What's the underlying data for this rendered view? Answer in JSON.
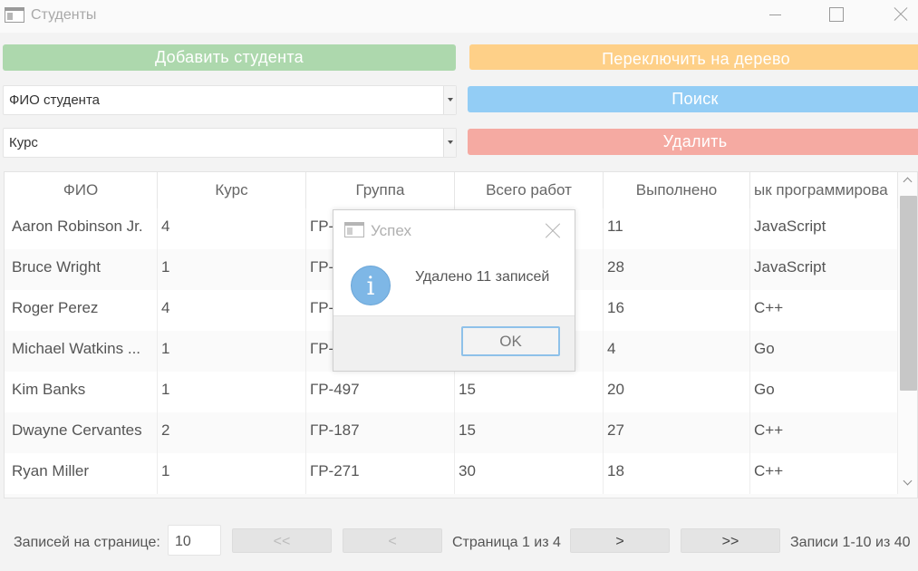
{
  "window": {
    "title": "Студенты"
  },
  "toolbar": {
    "add_label": "Добавить студента",
    "tree_label": "Переключить на дерево",
    "search_label": "Поиск",
    "delete_label": "Удалить",
    "colors": {
      "add": "#add8ad",
      "tree": "#fed088",
      "search": "#93cdf5",
      "delete": "#f5aaa2"
    }
  },
  "filters": {
    "fio_combo": "ФИО студента",
    "kurs_combo": "Курс"
  },
  "table": {
    "columns": [
      "ФИО",
      "Курс",
      "Группа",
      "Всего работ",
      "Выполнено",
      "Язык программирования"
    ],
    "column_visible_text": [
      "ФИО",
      "Курс",
      "Группа",
      "Всего работ",
      "Выполнено",
      "ык программирова"
    ],
    "rows": [
      [
        "Aaron Robinson Jr.",
        "4",
        "ГР-",
        "",
        "11",
        "JavaScript"
      ],
      [
        "Bruce Wright",
        "1",
        "ГР-",
        "",
        "28",
        "JavaScript"
      ],
      [
        "Roger Perez",
        "4",
        "ГР-",
        "",
        "16",
        "C++"
      ],
      [
        "Michael Watkins ...",
        "1",
        "ГР-",
        "",
        "4",
        "Go"
      ],
      [
        "Kim Banks",
        "1",
        "ГР-497",
        "15",
        "20",
        "Go"
      ],
      [
        "Dwayne Cervantes",
        "2",
        "ГР-187",
        "15",
        "27",
        "C++"
      ],
      [
        "Ryan Miller",
        "1",
        "ГР-271",
        "30",
        "18",
        "C++"
      ]
    ]
  },
  "pager": {
    "page_size_label": "Записей на странице:",
    "page_size": "10",
    "first": "<<",
    "prev": "<",
    "next": ">",
    "last": ">>",
    "page_info": "Страница 1 из 4",
    "records_info": "Записи 1-10 из 40"
  },
  "dialog": {
    "title": "Успех",
    "message": "Удалено 11 записей",
    "ok_label": "OK",
    "icon": "info-icon"
  }
}
